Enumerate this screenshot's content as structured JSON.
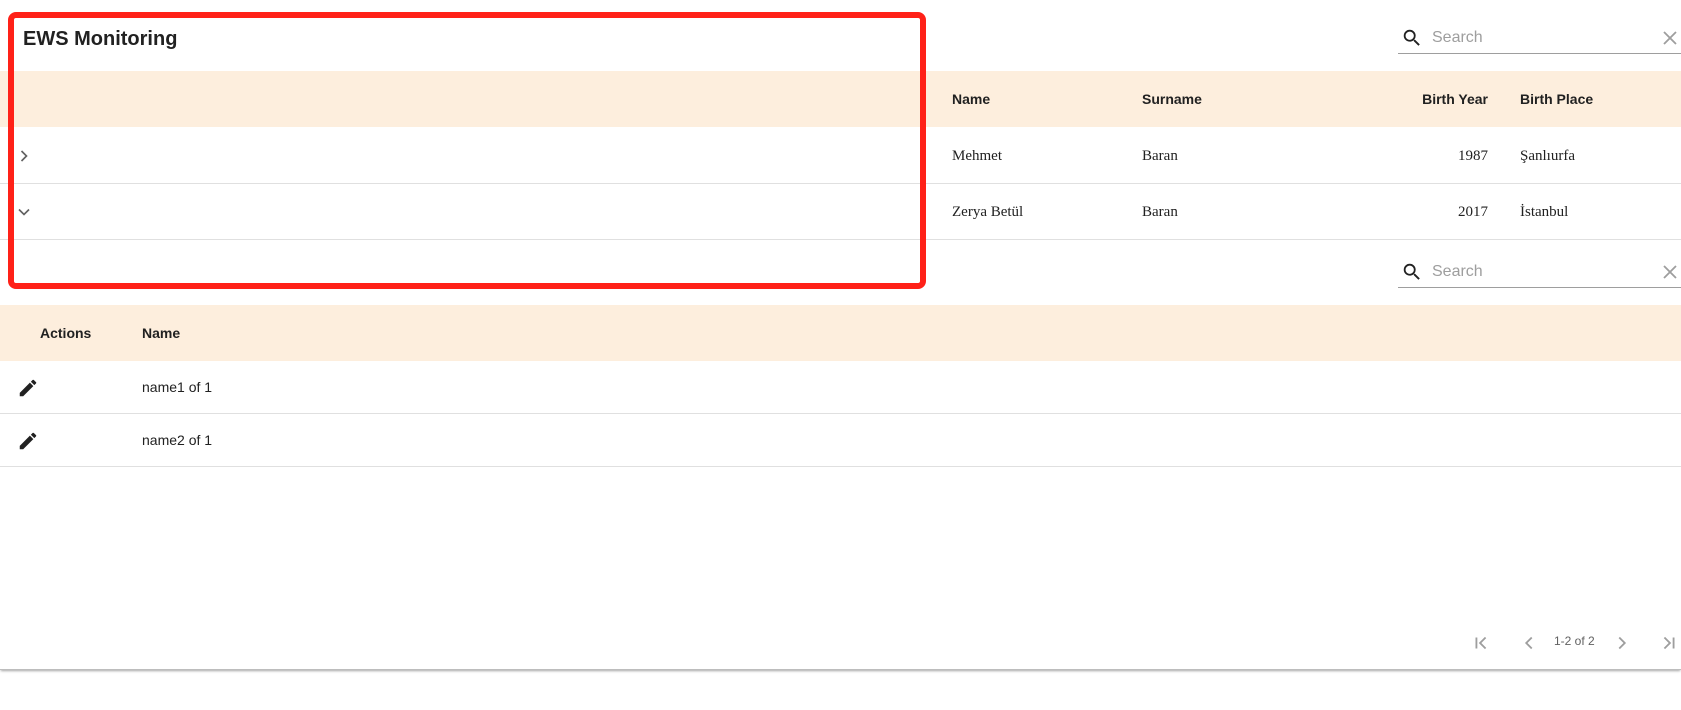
{
  "toolbar": {
    "title": "EWS Monitoring"
  },
  "search_top": {
    "placeholder": "Search"
  },
  "search_bottom": {
    "placeholder": "Search"
  },
  "people_table": {
    "headers": [
      "Name",
      "Surname",
      "Birth Year",
      "Birth Place"
    ],
    "rows": [
      {
        "name": "Mehmet",
        "surname": "Baran",
        "birth_year": "1987",
        "birth_place": "Şanlıurfa",
        "expanded": false
      },
      {
        "name": "Zerya Betül",
        "surname": "Baran",
        "birth_year": "2017",
        "birth_place": "İstanbul",
        "expanded": true
      }
    ]
  },
  "detail_table": {
    "headers": [
      "Actions",
      "Name"
    ],
    "rows": [
      {
        "name": "name1 of 1",
        "action_icon": "edit-icon"
      },
      {
        "name": "name2 of 1",
        "action_icon": "edit-icon"
      }
    ]
  },
  "paginator": {
    "range_label": "1-2 of 2"
  },
  "colors": {
    "header_bg": "#fdeedd",
    "highlight": "#ff2118"
  }
}
